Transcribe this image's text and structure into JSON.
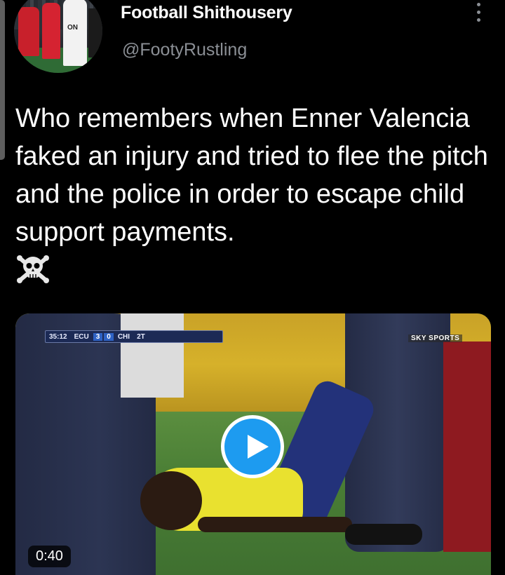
{
  "tweet": {
    "display_name": "Football Shithousery",
    "handle": "@FootyRustling",
    "text": "Who remembers when Enner Valencia faked an injury and tried to flee the pitch and the police in order to escape child support payments.",
    "emoji_icon": "skull-and-crossbones-icon",
    "avatar_icon": "avatar-photo",
    "more_icon": "more-vertical-icon"
  },
  "media": {
    "type": "video",
    "duration": "0:40",
    "play_icon": "play-icon",
    "scoreboard": {
      "clock": "35:12",
      "home": "ECU",
      "home_score": "3",
      "away_score": "0",
      "away": "CHI",
      "period": "2T"
    },
    "broadcaster": "SKY SPORTS"
  },
  "colors": {
    "background": "#000000",
    "secondary_text": "#8b8f95",
    "play_button": "#1d9bf0"
  }
}
